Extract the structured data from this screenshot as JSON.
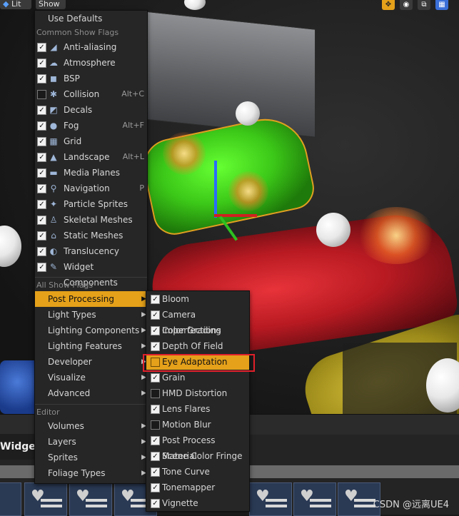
{
  "toolbar": {
    "lit_label": "Lit",
    "show_label": "Show",
    "icons": [
      "transform-gizmo-icon",
      "globe-icon",
      "snap-icon",
      "grid-icon"
    ]
  },
  "main_menu": {
    "use_defaults": "Use Defaults",
    "common_header": "Common Show Flags",
    "common_items": [
      {
        "label": "Anti-aliasing",
        "checked": true,
        "icon": "anti-aliasing-icon",
        "shortcut": ""
      },
      {
        "label": "Atmosphere",
        "checked": true,
        "icon": "atmosphere-icon",
        "shortcut": ""
      },
      {
        "label": "BSP",
        "checked": true,
        "icon": "bsp-cube-icon",
        "shortcut": ""
      },
      {
        "label": "Collision",
        "checked": false,
        "icon": "collision-icon",
        "shortcut": "Alt+C"
      },
      {
        "label": "Decals",
        "checked": true,
        "icon": "decal-icon",
        "shortcut": ""
      },
      {
        "label": "Fog",
        "checked": true,
        "icon": "fog-icon",
        "shortcut": "Alt+F"
      },
      {
        "label": "Grid",
        "checked": true,
        "icon": "grid-icon",
        "shortcut": ""
      },
      {
        "label": "Landscape",
        "checked": true,
        "icon": "landscape-icon",
        "shortcut": "Alt+L"
      },
      {
        "label": "Media Planes",
        "checked": true,
        "icon": "media-plane-icon",
        "shortcut": ""
      },
      {
        "label": "Navigation",
        "checked": true,
        "icon": "navigation-icon",
        "shortcut": "P"
      },
      {
        "label": "Particle Sprites",
        "checked": true,
        "icon": "particle-icon",
        "shortcut": ""
      },
      {
        "label": "Skeletal Meshes",
        "checked": true,
        "icon": "skeletal-mesh-icon",
        "shortcut": ""
      },
      {
        "label": "Static Meshes",
        "checked": true,
        "icon": "static-mesh-icon",
        "shortcut": ""
      },
      {
        "label": "Translucency",
        "checked": true,
        "icon": "translucency-icon",
        "shortcut": ""
      },
      {
        "label": "Widget Components",
        "checked": true,
        "icon": "widget-component-icon",
        "shortcut": ""
      }
    ],
    "all_header": "All Show Flags",
    "all_items": [
      {
        "label": "Post Processing",
        "highlighted": true
      },
      {
        "label": "Light Types",
        "highlighted": false
      },
      {
        "label": "Lighting Components",
        "highlighted": false
      },
      {
        "label": "Lighting Features",
        "highlighted": false
      },
      {
        "label": "Developer",
        "highlighted": false
      },
      {
        "label": "Visualize",
        "highlighted": false
      },
      {
        "label": "Advanced",
        "highlighted": false
      }
    ],
    "editor_header": "Editor",
    "editor_items": [
      {
        "label": "Volumes"
      },
      {
        "label": "Layers"
      },
      {
        "label": "Sprites"
      },
      {
        "label": "Foliage Types"
      }
    ]
  },
  "submenu": {
    "items": [
      {
        "label": "Bloom",
        "checked": true,
        "boxed": false
      },
      {
        "label": "Camera Imperfections",
        "checked": true,
        "boxed": false
      },
      {
        "label": "Color Grading",
        "checked": true,
        "boxed": false
      },
      {
        "label": "Depth Of Field",
        "checked": true,
        "boxed": false
      },
      {
        "label": "Eye Adaptation",
        "checked": false,
        "boxed": true
      },
      {
        "label": "Grain",
        "checked": true,
        "boxed": false
      },
      {
        "label": "HMD Distortion",
        "checked": false,
        "boxed": false
      },
      {
        "label": "Lens Flares",
        "checked": true,
        "boxed": false
      },
      {
        "label": "Motion Blur",
        "checked": false,
        "boxed": false
      },
      {
        "label": "Post Process Material",
        "checked": true,
        "boxed": false
      },
      {
        "label": "Scene Color Fringe",
        "checked": true,
        "boxed": false
      },
      {
        "label": "Tone Curve",
        "checked": true,
        "boxed": false
      },
      {
        "label": "Tonemapper",
        "checked": true,
        "boxed": false
      },
      {
        "label": "Vignette",
        "checked": true,
        "boxed": false
      }
    ]
  },
  "lower_panel": {
    "tab_label": "Widget",
    "tile_count_label": ""
  },
  "watermark": "CSDN @远离UE4",
  "colors": {
    "highlight": "#e5a11a",
    "callout_border": "#e0202a",
    "menu_bg": "#262626"
  }
}
